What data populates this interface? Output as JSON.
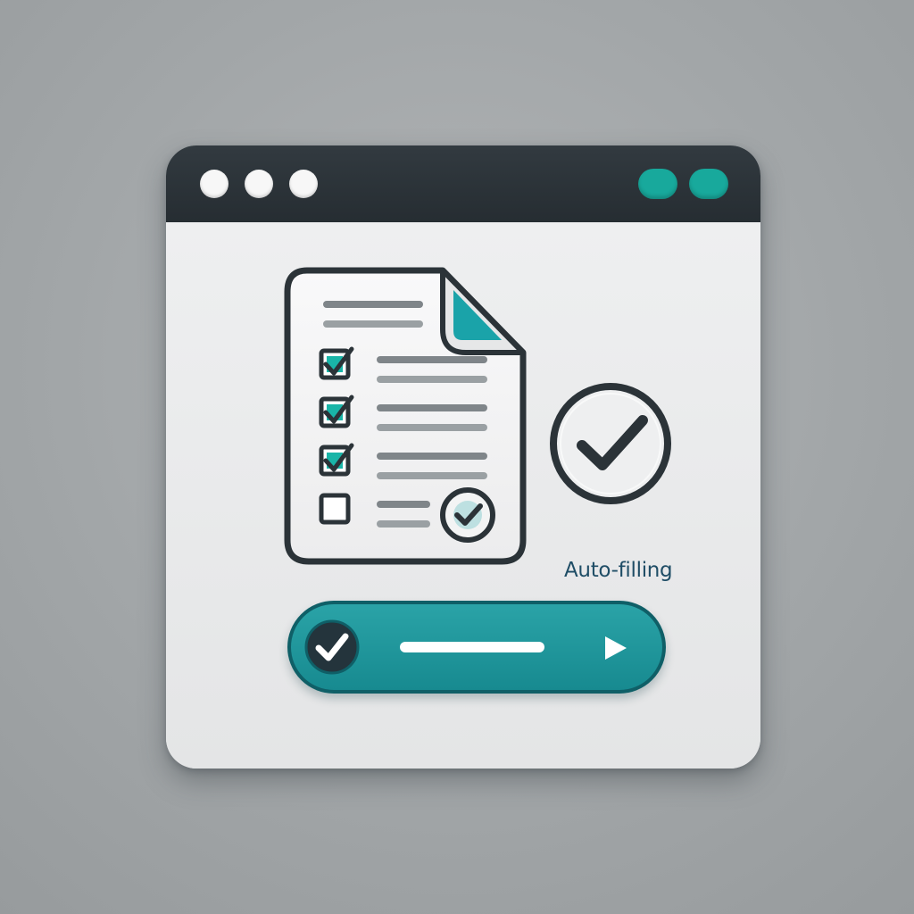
{
  "window": {
    "title_dots": [
      "dot-1",
      "dot-2",
      "dot-3"
    ],
    "title_pills": [
      "pill-1",
      "pill-2"
    ]
  },
  "document": {
    "rows": [
      {
        "checked": true
      },
      {
        "checked": true
      },
      {
        "checked": true
      },
      {
        "checked": false
      }
    ]
  },
  "status": {
    "label": "Auto-filling"
  },
  "action": {
    "icons": [
      "check-circle-icon",
      "progress-line",
      "arrow-right-icon"
    ]
  },
  "colors": {
    "accent": "#18a99c",
    "dark": "#2b3338",
    "action_bar": "#1e969b",
    "label": "#1f4d66"
  }
}
